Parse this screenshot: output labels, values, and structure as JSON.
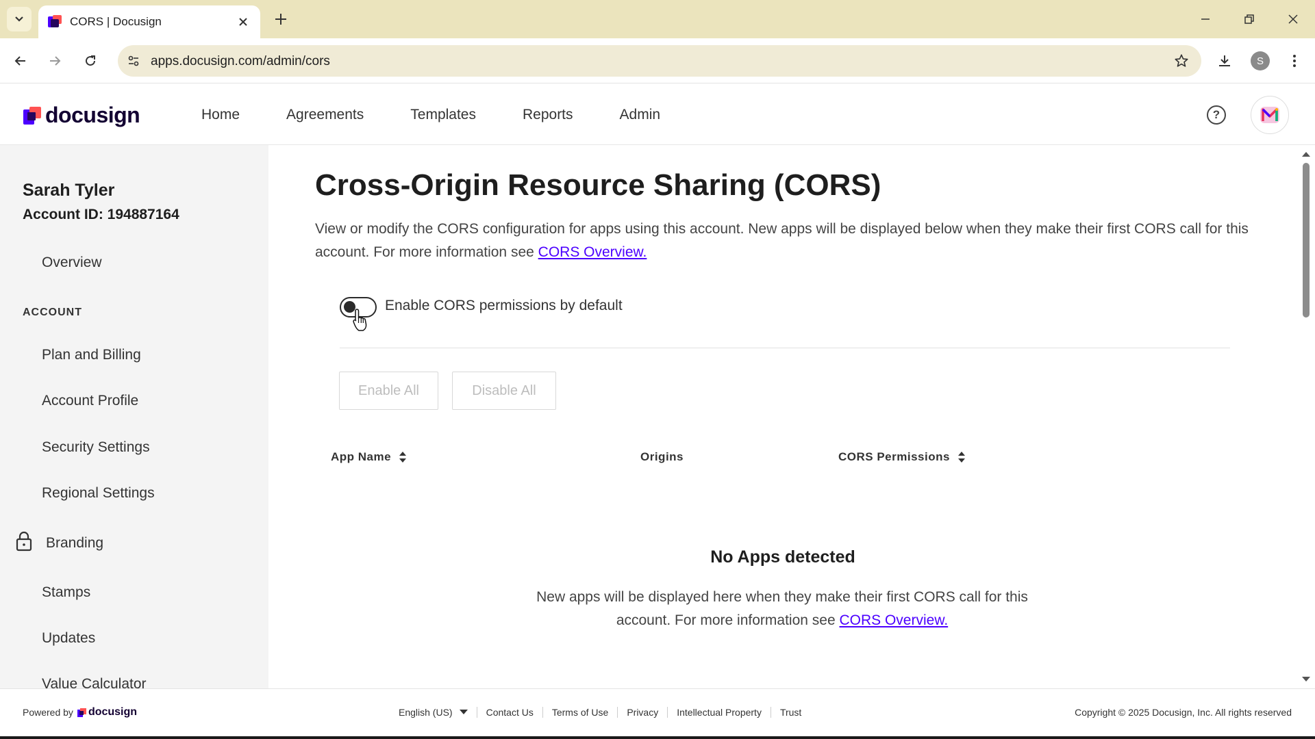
{
  "browser": {
    "tab_title": "CORS | Docusign",
    "url": "apps.docusign.com/admin/cors",
    "profile_initial": "S"
  },
  "header": {
    "logo_text": "docusign",
    "nav": [
      "Home",
      "Agreements",
      "Templates",
      "Reports",
      "Admin"
    ],
    "avatar_initial": "M"
  },
  "sidebar": {
    "user_name": "Sarah Tyler",
    "account_id": "Account ID: 194887164",
    "overview": "Overview",
    "section_label": "ACCOUNT",
    "items": [
      "Plan and Billing",
      "Account Profile",
      "Security Settings",
      "Regional Settings",
      "Branding",
      "Stamps",
      "Updates",
      "Value Calculator"
    ]
  },
  "main": {
    "title": "Cross-Origin Resource Sharing (CORS)",
    "description": "View or modify the CORS configuration for apps using this account. New apps will be displayed below when they make their first CORS call for this account. For more information see",
    "description_link": "CORS Overview.",
    "toggle_label": "Enable CORS permissions by default",
    "toggle_on": false,
    "enable_all": "Enable All",
    "disable_all": "Disable All",
    "columns": [
      "App Name",
      "Origins",
      "CORS Permissions"
    ],
    "empty_title": "No Apps detected",
    "empty_description": "New apps will be displayed here when they make their first CORS call for this account. For more information see",
    "empty_link": "CORS Overview."
  },
  "footer": {
    "powered_by": "Powered by",
    "logo_text": "docusign",
    "language": "English (US)",
    "links": [
      "Contact Us",
      "Terms of Use",
      "Privacy",
      "Intellectual Property",
      "Trust"
    ],
    "copyright": "Copyright © 2025 Docusign, Inc. All rights reserved"
  },
  "colors": {
    "brand_purple": "#4c00ff",
    "brand_dark": "#130032",
    "chrome_bg": "#ebe4bd"
  }
}
